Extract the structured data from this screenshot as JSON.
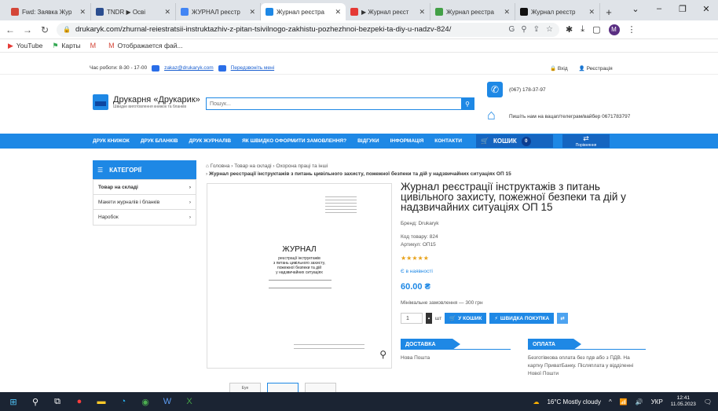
{
  "browser": {
    "tabs": [
      {
        "label": "Fwd: Заявка Жур",
        "color": "#d44638",
        "active": false
      },
      {
        "label": "TNDR ▶ Осві",
        "color": "#2a4d8f",
        "active": false
      },
      {
        "label": "ЖУРНАЛ реєстр",
        "color": "#4285f4",
        "active": false
      },
      {
        "label": "Журнал реєстра",
        "color": "#1e88e5",
        "active": true
      },
      {
        "label": "▶ Журнал реєст",
        "color": "#e53935",
        "active": false
      },
      {
        "label": "Журнал реєстра",
        "color": "#43a047",
        "active": false
      },
      {
        "label": "Журнал реєстр",
        "color": "#111111",
        "active": false
      }
    ],
    "url": "drukaryk.com/zhurnal-reiestratsii-instruktazhiv-z-pitan-tsivilnogo-zakhistu-pozhezhnoi-bezpeki-ta-diy-u-nadzv-824/",
    "avatar_letter": "M",
    "bookmarks": [
      {
        "label": "YouTube",
        "icon": "youtube-icon",
        "color": "#e53935"
      },
      {
        "label": "Карты",
        "icon": "maps-icon",
        "color": "#34a853"
      },
      {
        "label": "",
        "icon": "gmail-icon",
        "color": "#d44638"
      },
      {
        "label": "Отображается фай...",
        "icon": "gmail-icon",
        "color": "#d44638"
      }
    ]
  },
  "site": {
    "topbar": {
      "hours": "Час роботи: 8-30 - 17-00",
      "email": "zakaz@drukaryk.com",
      "callback": "Передзвоніть мені",
      "login": "Вхід",
      "register": "Реєстрація"
    },
    "logo": {
      "name": "Друкарня «Друкарик»",
      "tagline": "Швидке виготовлення книжок та бланків"
    },
    "search_placeholder": "Пошук...",
    "phone": "(067) 178-37-97",
    "messenger": "Пишіть нам на вацап/телеграм/вайбер 0671783797",
    "nav": [
      "ДРУК КНИЖОК",
      "ДРУК БЛАНКІВ",
      "ДРУК ЖУРНАЛІВ",
      "ЯК ШВИДКО ОФОРМИТИ ЗАМОВЛЕННЯ?",
      "ВІДГУКИ",
      "ІНФОРМАЦІЯ",
      "КОНТАКТИ"
    ],
    "cart_label": "КОШИК",
    "cart_count": "0",
    "compare_label": "Порівняння",
    "categories_title": "КАТЕГОРІЇ",
    "categories": [
      "Товар на складі",
      "Макети журналів і бланків",
      "Наробок"
    ],
    "breadcrumb": {
      "home": "Головна",
      "c1": "Товар на складі",
      "c2": "Охорона праці та інші",
      "current": "Журнал реєстрації інструктажів з питань цивільного захисту, пожежної безпеки та дій у надзвичайних ситуаціях ОП 15"
    },
    "product": {
      "title": "Журнал реєстрації інструктажів з питань цивільного захисту, пожежної безпеки та дій у надзвичайних ситуаціях ОП 15",
      "brand": "Бренд: Drukaryk",
      "code": "Код товару: 824",
      "sku": "Артикул: ОП15",
      "rating": 5,
      "stock": "Є в наявності",
      "price": "60.00 ₴",
      "min_order": "Мінімальне замовлення — 300 грн",
      "qty": "1",
      "unit": "шт",
      "add_to_cart": "У КОШИК",
      "quick_buy": "ШВИДКА ПОКУПКА",
      "doc_title": "ЖУРНАЛ",
      "doc_subtitle": [
        "реєстрації інструктажів",
        "з питань цивільного захисту,",
        "пожежної безпеки та дій",
        "у надзвичайних ситуаціях"
      ],
      "thumb_label": "Eye"
    },
    "delivery": {
      "title": "ДОСТАВКА",
      "text": "Нова Пошта"
    },
    "payment": {
      "title": "ОПЛАТА",
      "text": "Безготівкова оплата без пдв або з ПДВ. На картку ПриватБанку. Післяплата у відділенні Нової Пошти"
    }
  },
  "taskbar": {
    "weather": "16°C  Mostly cloudy",
    "lang": "УКР",
    "time": "12:41",
    "date": "11.05.2023"
  }
}
